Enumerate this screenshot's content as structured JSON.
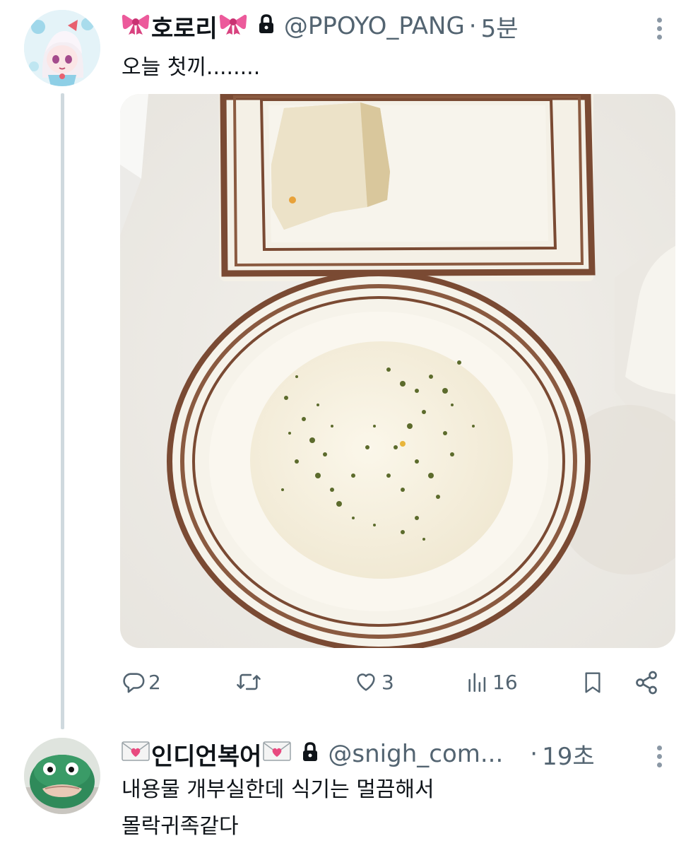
{
  "tweet": {
    "author_name": "호로리",
    "author_handle": "@PPOYO_PANG",
    "separator": "·",
    "time": "5분",
    "text": "오늘 첫끼........",
    "avatar_icon": "anime-girl-avatar",
    "actions": {
      "replies": "2",
      "retweets": "",
      "likes": "3",
      "views": "16"
    }
  },
  "reply": {
    "author_name": "인디언복어",
    "author_handle": "@snigh_com...",
    "separator": "·",
    "time": "19초",
    "text_line1": "내용물 개부실한데 식기는 멀끔해서",
    "text_line2": "몰락귀족같다",
    "avatar_icon": "green-fish-plush-avatar"
  },
  "colors": {
    "text": "#0f1419",
    "secondary": "#536471",
    "thread_line": "#cfd9de"
  }
}
